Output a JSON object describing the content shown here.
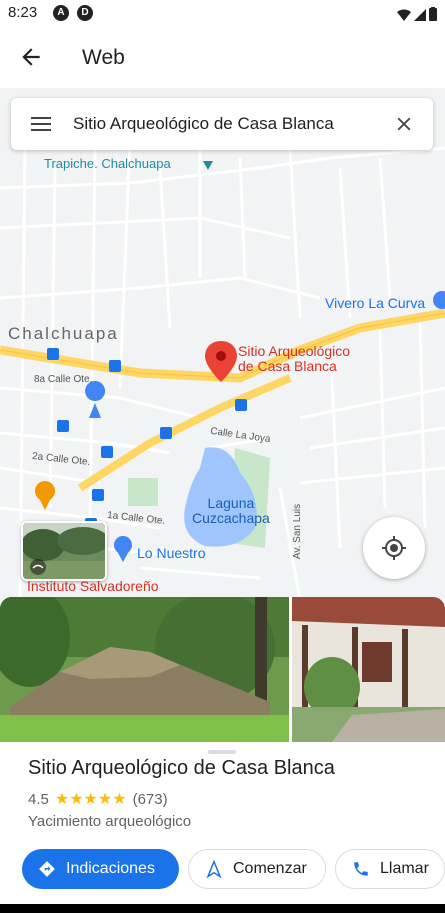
{
  "status_bar": {
    "time": "8:23"
  },
  "app_bar": {
    "title": "Web"
  },
  "search": {
    "query": "Sitio Arqueológico de Casa Blanca"
  },
  "map": {
    "labels": {
      "trapiche": "Trapiche. Chalchuapa",
      "vivero": "Vivero La Curva",
      "chalchuapa": "Chalchuapa",
      "calle8a": "8a Calle Ote.",
      "calle2a": "2a Calle Ote.",
      "calle1a": "1a Calle Ote.",
      "calle_la_joya": "Calle La Joya",
      "av_san_luis": "Av. San Luis",
      "laguna": "Laguna\nCuzcachapa",
      "lo_nuestro": "Lo Nuestro",
      "instituto": "Instituto Salvadoreño"
    },
    "place_pin_label": "Sitio Arqueológico\nde Casa Blanca",
    "colors": {
      "road_major": "#fdd663",
      "water": "#9ec5fe",
      "pin": "#ea4335",
      "poi_blue": "#4285f4",
      "food": "#f29900",
      "park": "#c8e6c9"
    }
  },
  "place": {
    "name": "Sitio Arqueológico de Casa Blanca",
    "rating": "4.5",
    "stars": "★★★★★",
    "reviews": "(673)",
    "type": "Yacimiento arqueológico"
  },
  "actions": {
    "directions": "Indicaciones",
    "start": "Comenzar",
    "call": "Llamar"
  }
}
